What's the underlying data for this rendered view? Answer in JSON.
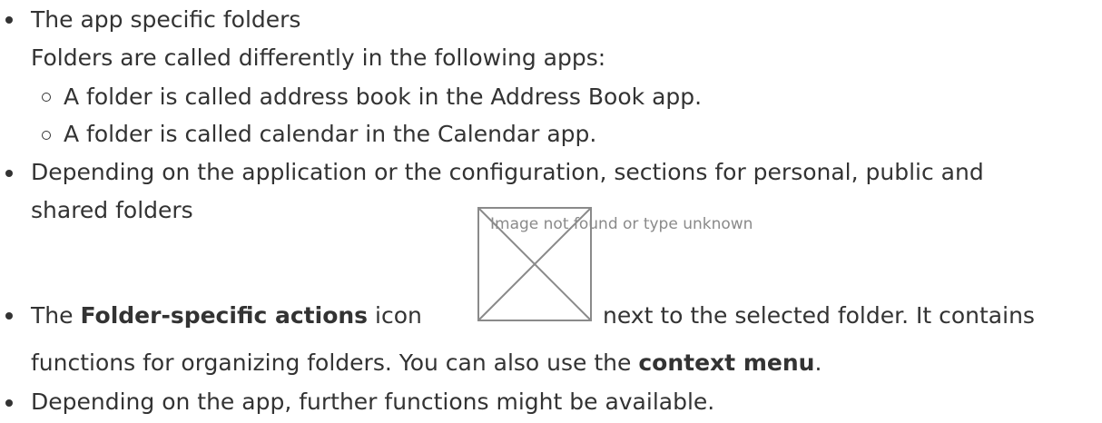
{
  "list": {
    "item1": {
      "label": "The app specific folders",
      "note": "Folders are called differently in the following apps:",
      "sub1": "A folder is called address book in the Address Book app.",
      "sub2": "A folder is called calendar in the Calendar app."
    },
    "item2": {
      "line1": "Depending on the application or the configuration, sections for personal, public and",
      "line2": "shared folders"
    },
    "item3": {
      "prefix": "The ",
      "bold1": "Folder-specific actions",
      "mid": " icon",
      "after_icon": "next to the selected folder. It contains",
      "line2_prefix": "functions for organizing folders. You can also use the ",
      "bold2": "context menu",
      "line2_suffix": "."
    },
    "item4": {
      "label": "Depending on the app, further functions might be available."
    }
  },
  "broken_image": {
    "alt_text": "Image not found or type unknown",
    "icon": "broken-image-icon"
  }
}
